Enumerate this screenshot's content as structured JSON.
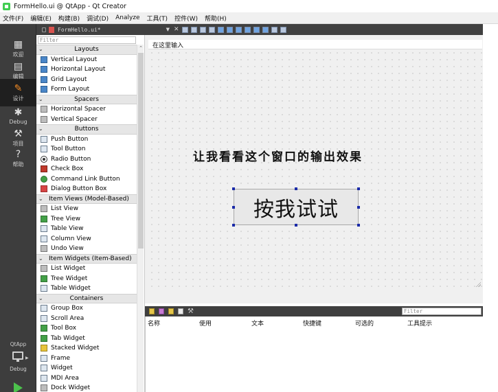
{
  "window": {
    "title": "FormHello.ui @ QtApp - Qt Creator"
  },
  "menubar": [
    "文件(F)",
    "编辑(E)",
    "构建(B)",
    "调试(D)",
    "Analyze",
    "工具(T)",
    "控件(W)",
    "帮助(H)"
  ],
  "modes": [
    {
      "label": "欢迎",
      "icon": "grid-icon"
    },
    {
      "label": "编辑",
      "icon": "document-icon"
    },
    {
      "label": "设计",
      "icon": "pencil-icon"
    },
    {
      "label": "Debug",
      "icon": "bug-icon"
    },
    {
      "label": "项目",
      "icon": "wrench-icon"
    },
    {
      "label": "帮助",
      "icon": "help-icon"
    }
  ],
  "kit": {
    "project": "QtApp",
    "config": "Debug"
  },
  "editor": {
    "document": "FormHello.ui*"
  },
  "widget_box": {
    "filter_placeholder": "Filter",
    "categories": [
      {
        "name": "Layouts",
        "items": [
          {
            "label": "Vertical Layout",
            "icon": "vertical-layout-icon"
          },
          {
            "label": "Horizontal Layout",
            "icon": "horizontal-layout-icon"
          },
          {
            "label": "Grid Layout",
            "icon": "grid-layout-icon"
          },
          {
            "label": "Form Layout",
            "icon": "form-layout-icon"
          }
        ]
      },
      {
        "name": "Spacers",
        "items": [
          {
            "label": "Horizontal Spacer",
            "icon": "horizontal-spacer-icon"
          },
          {
            "label": "Vertical Spacer",
            "icon": "vertical-spacer-icon"
          }
        ]
      },
      {
        "name": "Buttons",
        "items": [
          {
            "label": "Push Button",
            "icon": "push-button-icon"
          },
          {
            "label": "Tool Button",
            "icon": "tool-button-icon"
          },
          {
            "label": "Radio Button",
            "icon": "radio-button-icon"
          },
          {
            "label": "Check Box",
            "icon": "check-box-icon"
          },
          {
            "label": "Command Link Button",
            "icon": "command-link-icon"
          },
          {
            "label": "Dialog Button Box",
            "icon": "dialog-button-box-icon"
          }
        ]
      },
      {
        "name": "Item Views (Model-Based)",
        "items": [
          {
            "label": "List View",
            "icon": "list-view-icon"
          },
          {
            "label": "Tree View",
            "icon": "tree-view-icon"
          },
          {
            "label": "Table View",
            "icon": "table-view-icon"
          },
          {
            "label": "Column View",
            "icon": "column-view-icon"
          },
          {
            "label": "Undo View",
            "icon": "undo-view-icon"
          }
        ]
      },
      {
        "name": "Item Widgets (Item-Based)",
        "items": [
          {
            "label": "List Widget",
            "icon": "list-widget-icon"
          },
          {
            "label": "Tree Widget",
            "icon": "tree-widget-icon"
          },
          {
            "label": "Table Widget",
            "icon": "table-widget-icon"
          }
        ]
      },
      {
        "name": "Containers",
        "items": [
          {
            "label": "Group Box",
            "icon": "group-box-icon"
          },
          {
            "label": "Scroll Area",
            "icon": "scroll-area-icon"
          },
          {
            "label": "Tool Box",
            "icon": "tool-box-icon"
          },
          {
            "label": "Tab Widget",
            "icon": "tab-widget-icon"
          },
          {
            "label": "Stacked Widget",
            "icon": "stacked-widget-icon"
          },
          {
            "label": "Frame",
            "icon": "frame-icon"
          },
          {
            "label": "Widget",
            "icon": "widget-icon"
          },
          {
            "label": "MDI Area",
            "icon": "mdi-area-icon"
          },
          {
            "label": "Dock Widget",
            "icon": "dock-widget-icon"
          }
        ]
      }
    ]
  },
  "form": {
    "menu_placeholder": "在这里输入",
    "label_text": "让我看看这个窗口的输出效果",
    "button_text": "按我试试"
  },
  "action_editor": {
    "filter_placeholder": "Filter",
    "columns": [
      "名称",
      "使用",
      "文本",
      "快捷键",
      "可选的",
      "工具提示"
    ]
  }
}
